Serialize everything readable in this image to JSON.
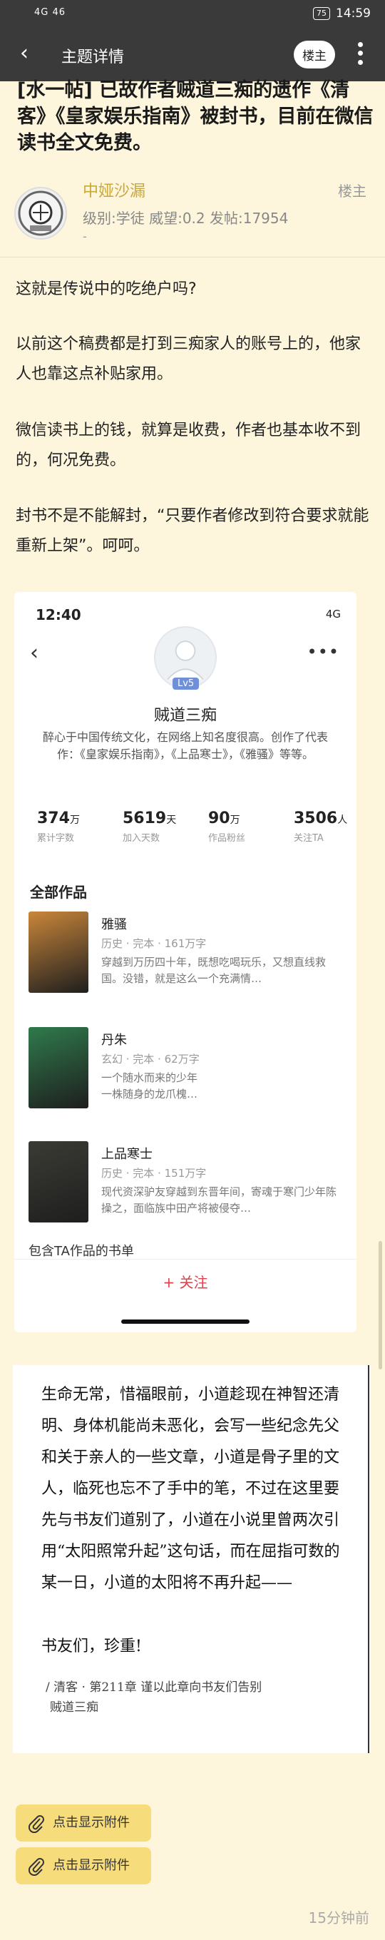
{
  "status_bar": {
    "signal": "4G 46",
    "battery": "75",
    "time": "14:59"
  },
  "nav": {
    "back_icon": "back-arrow-icon",
    "title": "主题详情",
    "owner_button": "楼主",
    "more_icon": "more-vertical-icon"
  },
  "topic": {
    "title": "[水一帖] 已故作者贼道三痴的遗作《清客》《皇家娱乐指南》被封书，目前在微信读书全文免费。"
  },
  "author": {
    "name": "中娅沙漏",
    "meta": "级别:学徒   威望:0.2   发帖:17954",
    "extra": "-",
    "floor_label": "楼主"
  },
  "post": {
    "paragraphs": [
      "这就是传说中的吃绝户吗?",
      "以前这个稿费都是打到三痴家人的账号上的，他家人也靠这点补贴家用。",
      "微信读书上的钱，就算是收费，作者也基本收不到的，何况免费。",
      "封书不是不能解封，“只要作者修改到符合要求就能重新上架”。呵呵。"
    ]
  },
  "embedded_profile": {
    "time": "12:40",
    "network": "4G",
    "level": "Lv5",
    "name": "贼道三痴",
    "bio": "醉心于中国传统文化，在网络上知名度很高。创作了代表作：《皇家娱乐指南》，《上品寒士》，《雅骚》等等。",
    "stats": [
      {
        "value": "374",
        "unit": "万",
        "label": "累计字数"
      },
      {
        "value": "5619",
        "unit": "天",
        "label": "加入天数"
      },
      {
        "value": "90",
        "unit": "万",
        "label": "作品粉丝"
      },
      {
        "value": "3506",
        "unit": "人",
        "label": "关注TA"
      }
    ],
    "works_heading": "全部作品",
    "works": [
      {
        "title": "雅骚",
        "meta": "历史 · 完本 · 161万字",
        "desc": "穿越到万历四十年，既想吃喝玩乐，又想直线救国。没错，就是这么一个充满情…",
        "cover_color": "#c9863a"
      },
      {
        "title": "丹朱",
        "meta": "玄幻 · 完本 · 62万字",
        "desc": "一个随水而来的少年\n一株随身的龙爪槐…",
        "cover_color": "#2f7a4c"
      },
      {
        "title": "上品寒士",
        "meta": "历史 · 完本 · 151万字",
        "desc": "现代资深驴友穿越到东晋年间，寄魂于寒门少年陈操之，面临族中田产将被侵夺…",
        "cover_color": "#3b3b35"
      }
    ],
    "booklist_label": "包含TA作品的书单",
    "follow_button": "+ 关注"
  },
  "quote": {
    "text": "生命无常，惜福眼前，小道趁现在神智还清明、身体机能尚未恶化，会写一些纪念先父和关于亲人的一些文章，小道是骨子里的文人，临死也忘不了手中的笔，不过在这里要先与书友们道别了，小道在小说里曾两次引用“太阳照常升起”这句话，而在屈指可数的某一日，小道的太阳将不再升起——",
    "sign": "书友们，珍重!",
    "source_line1": "/ 清客 · 第211章 谨以此章向书友们告别",
    "source_line2": "贼道三痴"
  },
  "attachments": [
    {
      "label": "点击显示附件"
    },
    {
      "label": "点击显示附件"
    }
  ],
  "post_time": "15分钟前"
}
